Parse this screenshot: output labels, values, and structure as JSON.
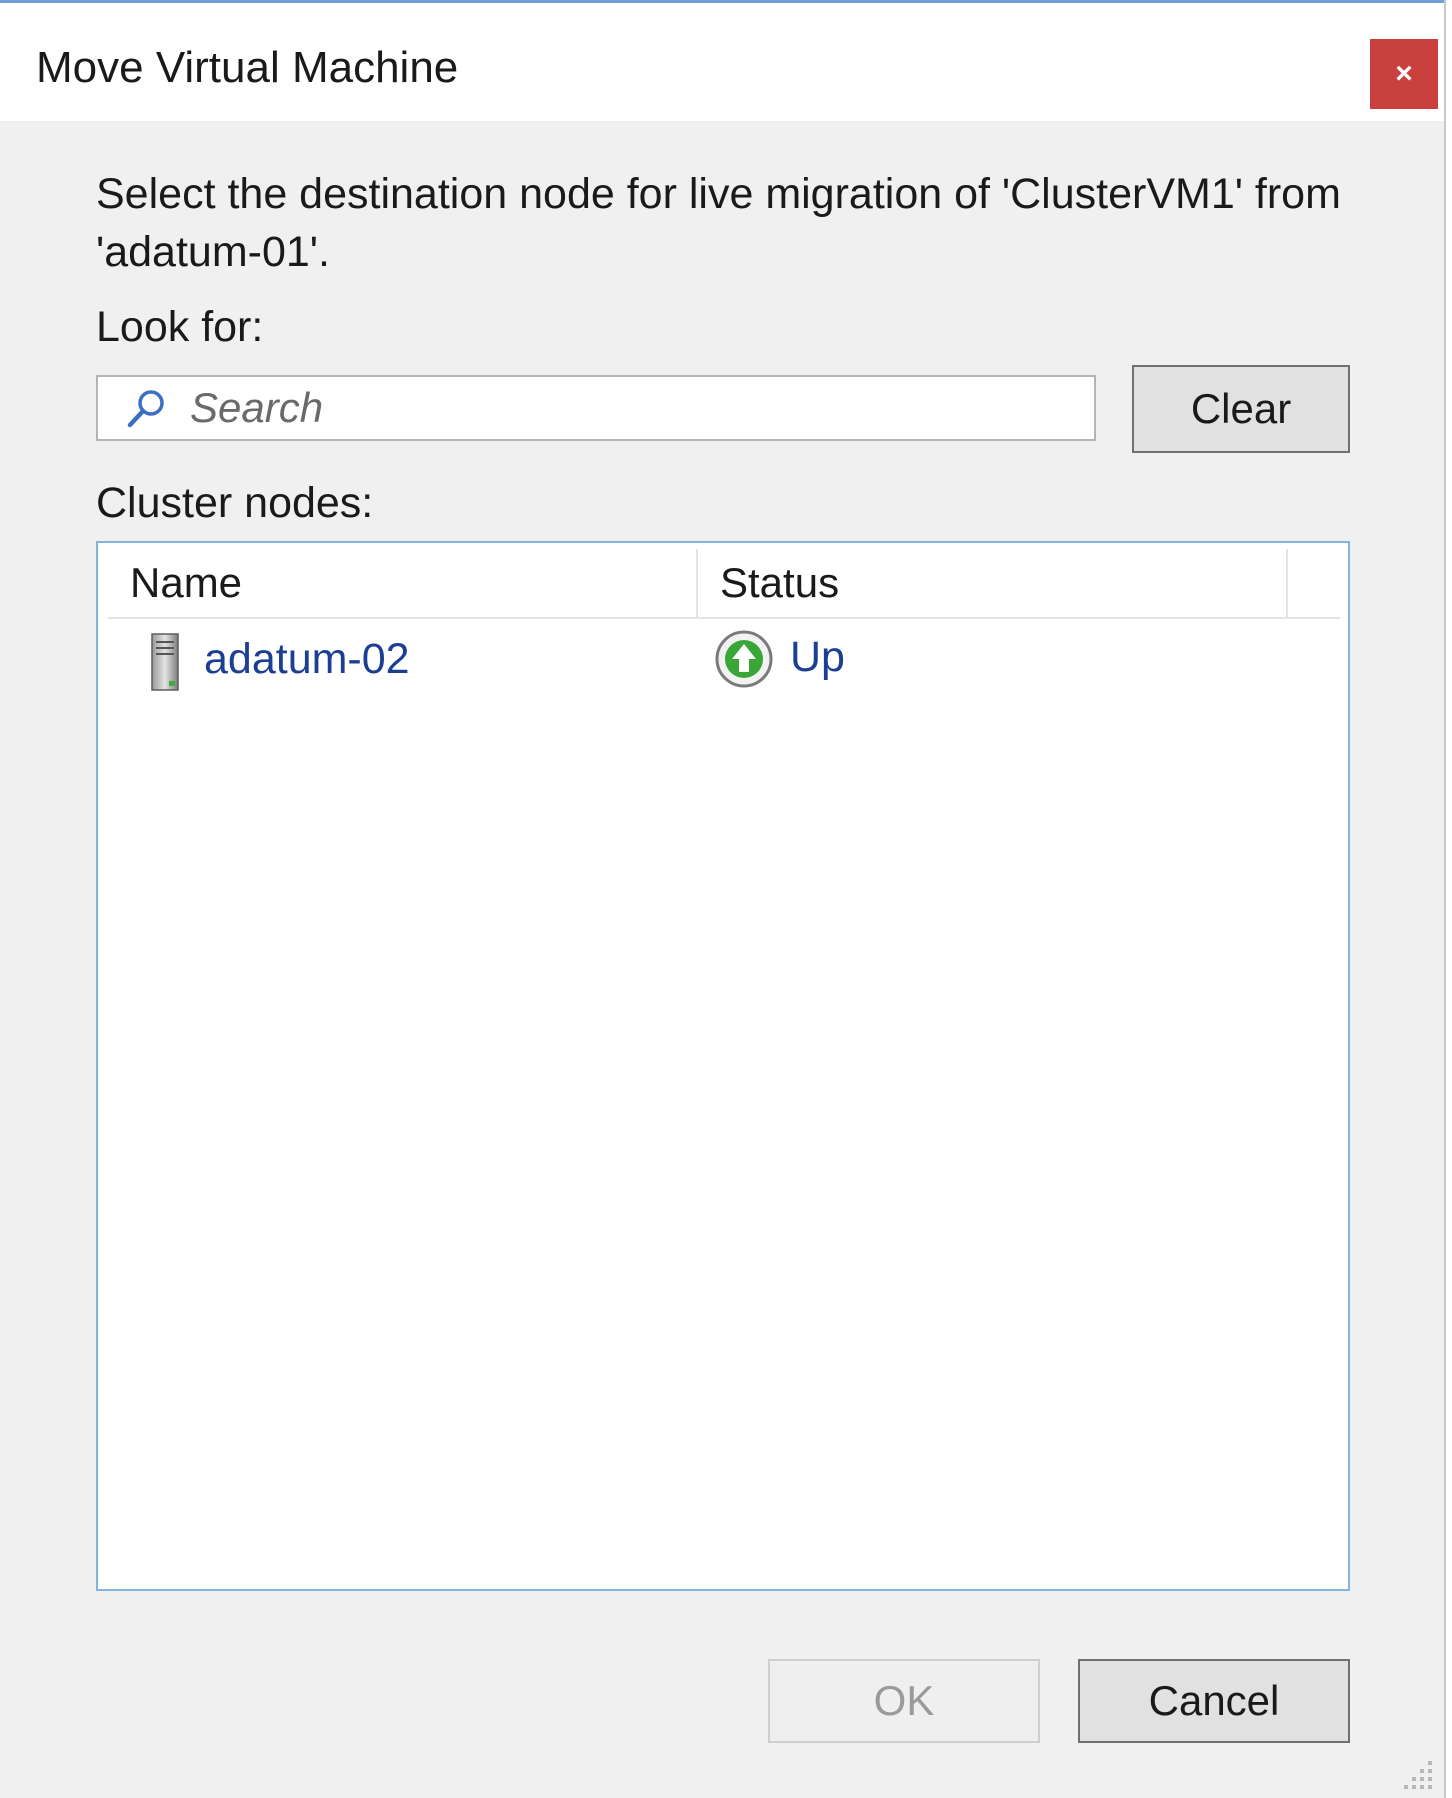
{
  "window": {
    "title": "Move Virtual Machine",
    "close_glyph": "×",
    "accent_color": "#6f9fd8",
    "close_color": "#c9403f"
  },
  "dialog": {
    "instruction": "Select the destination node for live migration of 'ClusterVM1' from 'adatum-01'.",
    "look_for_label": "Look for:",
    "search": {
      "placeholder": "Search",
      "value": "",
      "icon": "search-icon"
    },
    "clear_label": "Clear",
    "cluster_nodes_label": "Cluster nodes:",
    "columns": [
      "Name",
      "Status"
    ],
    "nodes": [
      {
        "name": "adatum-02",
        "status": "Up",
        "node_icon": "server-icon",
        "status_icon": "status-up-icon",
        "status_color": "#2e9e2e"
      }
    ],
    "ok_label": "OK",
    "cancel_label": "Cancel"
  }
}
